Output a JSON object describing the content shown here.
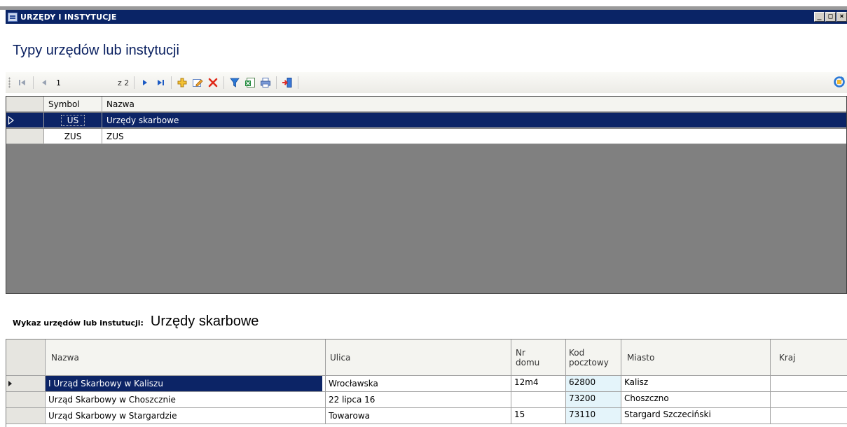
{
  "window": {
    "title": "URZĘDY I INSTYTUCJE",
    "buttons": [
      "_",
      "□",
      "×"
    ]
  },
  "page_title": "Typy urzędów lub instytucji",
  "toolbar": {
    "position_value": "1",
    "of_label": "z 2",
    "icons": [
      "first-icon",
      "prev-icon",
      "next-icon",
      "last-icon",
      "add-icon",
      "edit-icon",
      "delete-icon",
      "filter-icon",
      "excel-icon",
      "print-icon",
      "exit-icon",
      "refresh-icon"
    ]
  },
  "types_grid": {
    "columns": [
      "Symbol",
      "Nazwa"
    ],
    "rows": [
      {
        "symbol": "US",
        "nazwa": "Urzędy skarbowe"
      },
      {
        "symbol": "ZUS",
        "nazwa": "ZUS"
      }
    ]
  },
  "list_section": {
    "label": "Wykaz urzędów lub instutucji:",
    "selected_type": "Urzędy skarbowe"
  },
  "offices_grid": {
    "columns": {
      "nazwa": "Nazwa",
      "ulica": "Ulica",
      "nr_domu": "Nr domu",
      "kod": "Kod pocztowy",
      "miasto": "Miasto",
      "kraj": "Kraj"
    },
    "rows": [
      {
        "nazwa": "I Urząd Skarbowy w Kaliszu",
        "ulica": "Wrocławska",
        "nr_domu": "12m4",
        "kod": "62800",
        "miasto": "Kalisz",
        "kraj": ""
      },
      {
        "nazwa": "Urząd Skarbowy w Choszcznie",
        "ulica": "22 lipca 16",
        "nr_domu": "",
        "kod": "73200",
        "miasto": "Choszczno",
        "kraj": ""
      },
      {
        "nazwa": "Urząd Skarbowy w Stargardzie",
        "ulica": "Towarowa",
        "nr_domu": "15",
        "kod": "73110",
        "miasto": "Stargard Szczeciński",
        "kraj": ""
      }
    ]
  }
}
